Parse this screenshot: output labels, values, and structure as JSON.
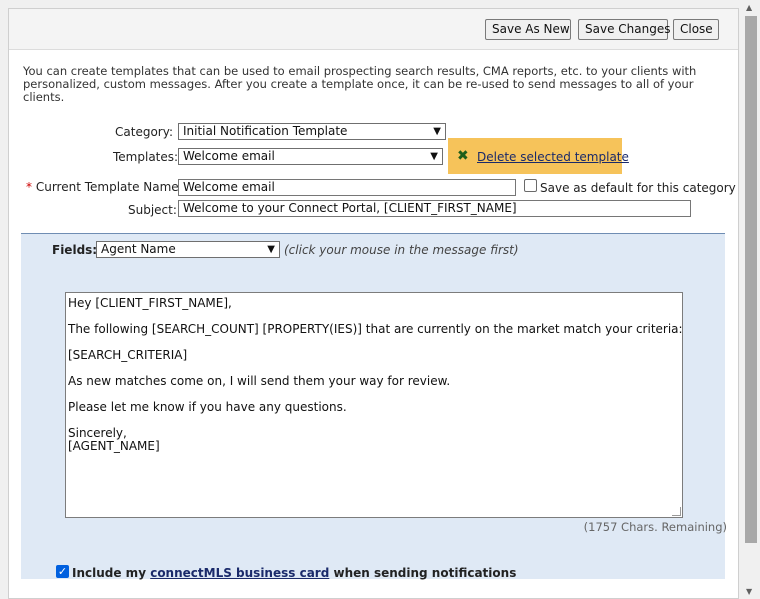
{
  "toolbar": {
    "save_as_new": "Save As New",
    "save_changes": "Save Changes",
    "close": "Close"
  },
  "intro_text": "You can create templates that can be used to email prospecting search results, CMA reports, etc. to your clients with personalized, custom messages. After you create a template once, it can be re-used to send messages to all of your clients.",
  "form": {
    "category_label": "Category:",
    "category_value": "Initial Notification Template",
    "templates_label": "Templates:",
    "templates_value": "Welcome email",
    "delete_link": "Delete selected template",
    "required_marker": "*",
    "name_label": "Current Template Name:",
    "name_value": "Welcome email",
    "default_checkbox_label": "Save as default for this category",
    "default_checked": false,
    "subject_label": "Subject:",
    "subject_value": "Welcome to your Connect Portal, [CLIENT_FIRST_NAME]"
  },
  "fields": {
    "label": "Fields:",
    "selected": "Agent Name",
    "hint": "(click your mouse in the message first)"
  },
  "message": {
    "lines": [
      "Hey [CLIENT_FIRST_NAME],",
      "The following [SEARCH_COUNT] [PROPERTY(IES)] that are currently on the market match your criteria:",
      "[SEARCH_CRITERIA]",
      "As new matches come on, I will send them your way for review.",
      "Please let me know if you have any questions.",
      "Sincerely,",
      "[AGENT_NAME]"
    ],
    "remaining": "(1757 Chars. Remaining)"
  },
  "business_card": {
    "checked": true,
    "prefix": "Include my",
    "link": "connectMLS business card",
    "suffix": "when sending notifications"
  },
  "icons": {
    "delete": "x-icon",
    "dropdown": "chevron-down-icon",
    "scroll_up": "scroll-up-arrow-icon",
    "scroll_down": "scroll-down-arrow-icon"
  },
  "colors": {
    "delete_highlight": "#f6c35a",
    "fields_panel_bg": "#dfe9f5",
    "link": "#1a2a6a",
    "required": "#cc0000",
    "checkbox_checked": "#0060df"
  }
}
